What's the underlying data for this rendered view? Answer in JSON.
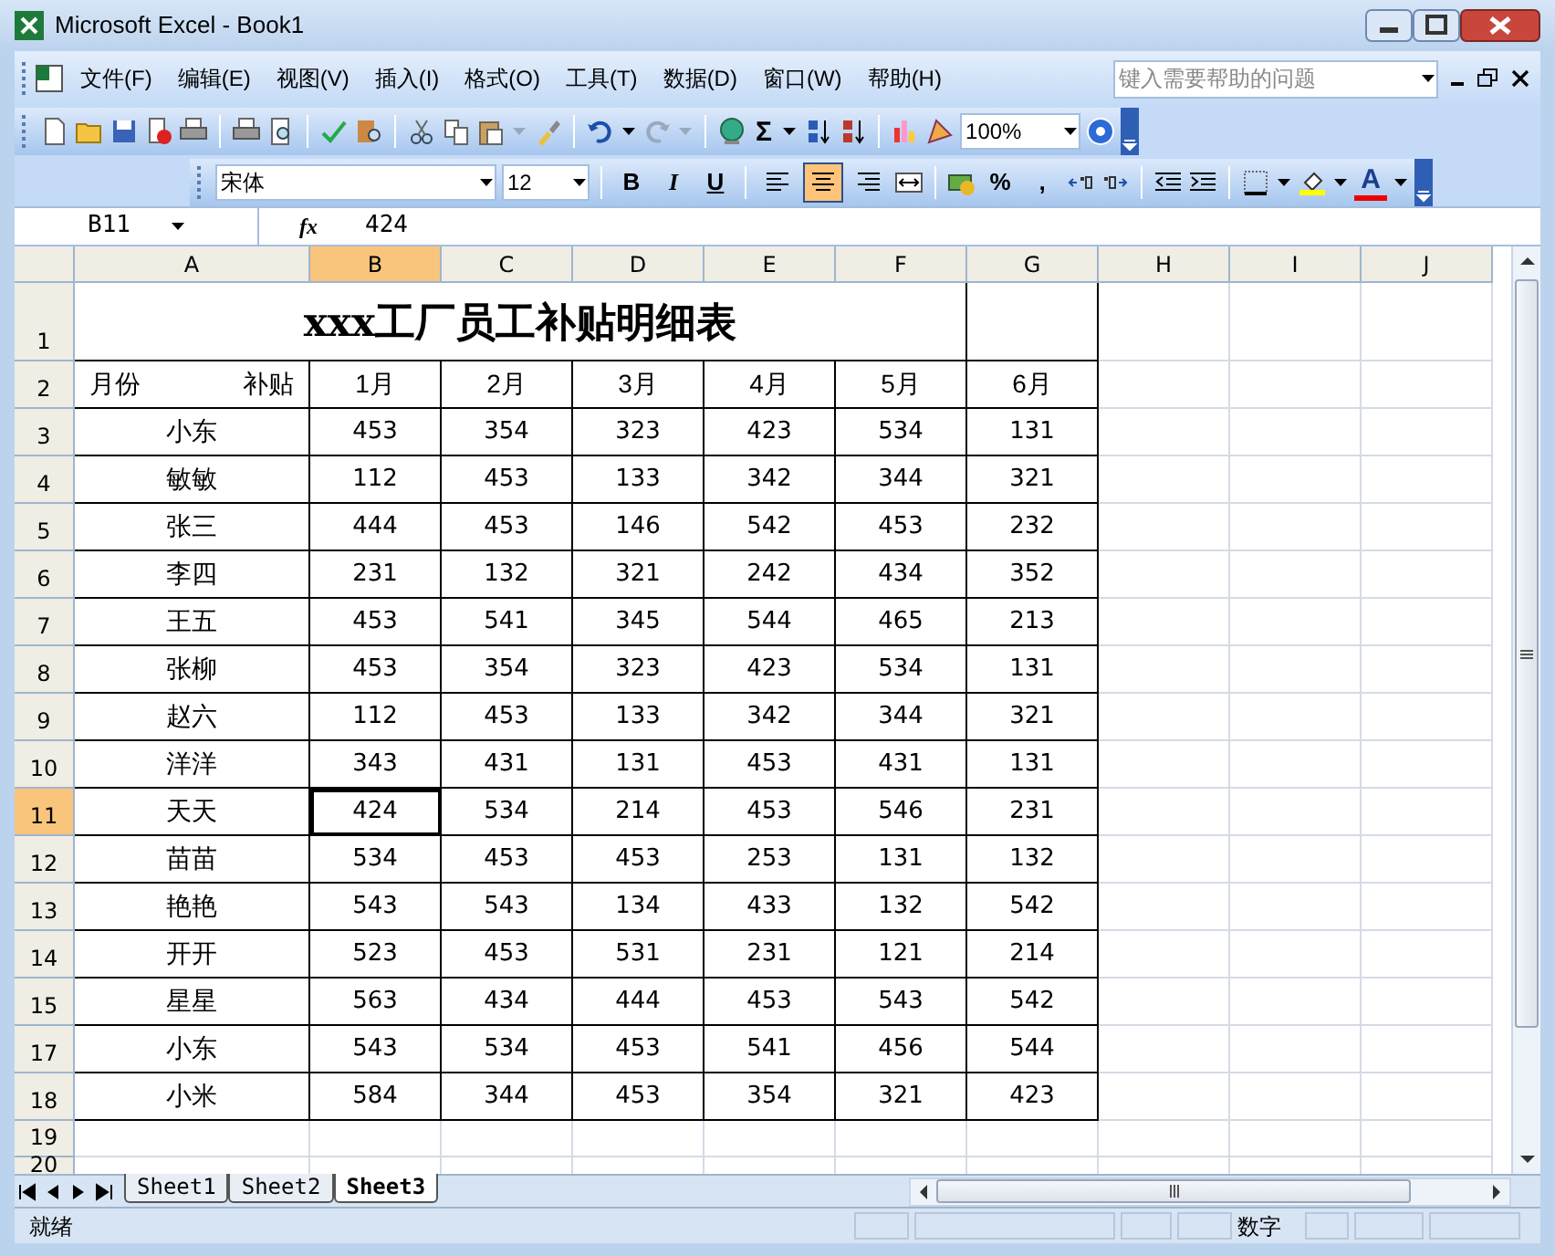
{
  "window": {
    "title": "Microsoft Excel - Book1"
  },
  "menu": [
    "文件(F)",
    "编辑(E)",
    "视图(V)",
    "插入(I)",
    "格式(O)",
    "工具(T)",
    "数据(D)",
    "窗口(W)",
    "帮助(H)"
  ],
  "help_box": {
    "placeholder": "键入需要帮助的问题"
  },
  "standard_toolbar": {
    "sum": "Σ",
    "zoom": "100%"
  },
  "formatting_toolbar": {
    "font": "宋体",
    "size": "12",
    "style_buttons": [
      {
        "kind": "bold",
        "label": "B"
      },
      {
        "kind": "italic",
        "label": "I"
      },
      {
        "kind": "underline",
        "label": "U"
      }
    ],
    "alignment": [
      {
        "kind": "left",
        "selected": false
      },
      {
        "kind": "center",
        "selected": true
      },
      {
        "kind": "right",
        "selected": false
      }
    ],
    "number_buttons": [
      "%",
      ","
    ],
    "font_color": "A"
  },
  "formula_bar": {
    "name_box": "B11",
    "fx": "fx",
    "value": "424"
  },
  "columns": [
    {
      "label": "A",
      "selected": false
    },
    {
      "label": "B",
      "selected": true
    },
    {
      "label": "C",
      "selected": false
    },
    {
      "label": "D",
      "selected": false
    },
    {
      "label": "E",
      "selected": false
    },
    {
      "label": "F",
      "selected": false
    },
    {
      "label": "G",
      "selected": false
    },
    {
      "label": "H",
      "selected": false
    },
    {
      "label": "I",
      "selected": false
    },
    {
      "label": "J",
      "selected": false
    }
  ],
  "title_row": {
    "header": "1",
    "title": "xxx工厂员工补贴明细表"
  },
  "header_row": {
    "header": "2",
    "corner_left": "月份",
    "corner_right": "补贴",
    "months": [
      "1月",
      "2月",
      "3月",
      "4月",
      "5月",
      "6月"
    ]
  },
  "rows": [
    {
      "header": "3",
      "selected": false,
      "cells": [
        "小东",
        "453",
        "354",
        "323",
        "423",
        "534",
        "131"
      ]
    },
    {
      "header": "4",
      "selected": false,
      "cells": [
        "敏敏",
        "112",
        "453",
        "133",
        "342",
        "344",
        "321"
      ]
    },
    {
      "header": "5",
      "selected": false,
      "cells": [
        "张三",
        "444",
        "453",
        "146",
        "542",
        "453",
        "232"
      ]
    },
    {
      "header": "6",
      "selected": false,
      "cells": [
        "李四",
        "231",
        "132",
        "321",
        "242",
        "434",
        "352"
      ]
    },
    {
      "header": "7",
      "selected": false,
      "cells": [
        "王五",
        "453",
        "541",
        "345",
        "544",
        "465",
        "213"
      ]
    },
    {
      "header": "8",
      "selected": false,
      "cells": [
        "张柳",
        "453",
        "354",
        "323",
        "423",
        "534",
        "131"
      ]
    },
    {
      "header": "9",
      "selected": false,
      "cells": [
        "赵六",
        "112",
        "453",
        "133",
        "342",
        "344",
        "321"
      ]
    },
    {
      "header": "10",
      "selected": false,
      "cells": [
        "洋洋",
        "343",
        "431",
        "131",
        "453",
        "431",
        "131"
      ]
    },
    {
      "header": "11",
      "selected": true,
      "cells": [
        "天天",
        "424",
        "534",
        "214",
        "453",
        "546",
        "231"
      ]
    },
    {
      "header": "12",
      "selected": false,
      "cells": [
        "苗苗",
        "534",
        "453",
        "453",
        "253",
        "131",
        "132"
      ]
    },
    {
      "header": "13",
      "selected": false,
      "cells": [
        "艳艳",
        "543",
        "543",
        "134",
        "433",
        "132",
        "542"
      ]
    },
    {
      "header": "14",
      "selected": false,
      "cells": [
        "开开",
        "523",
        "453",
        "531",
        "231",
        "121",
        "214"
      ]
    },
    {
      "header": "15",
      "selected": false,
      "cells": [
        "星星",
        "563",
        "434",
        "444",
        "453",
        "543",
        "542"
      ]
    },
    {
      "header": "17",
      "selected": false,
      "cells": [
        "小东",
        "543",
        "534",
        "453",
        "541",
        "456",
        "544"
      ]
    },
    {
      "header": "18",
      "selected": false,
      "cells": [
        "小米",
        "584",
        "344",
        "453",
        "354",
        "321",
        "423"
      ]
    }
  ],
  "empty_rows": [
    "19",
    "20"
  ],
  "sheet_tabs": [
    {
      "label": "Sheet1",
      "selected": false
    },
    {
      "label": "Sheet2",
      "selected": false
    },
    {
      "label": "Sheet3",
      "selected": true
    }
  ],
  "status_bar": {
    "left": "就绪",
    "mode": "数字"
  }
}
